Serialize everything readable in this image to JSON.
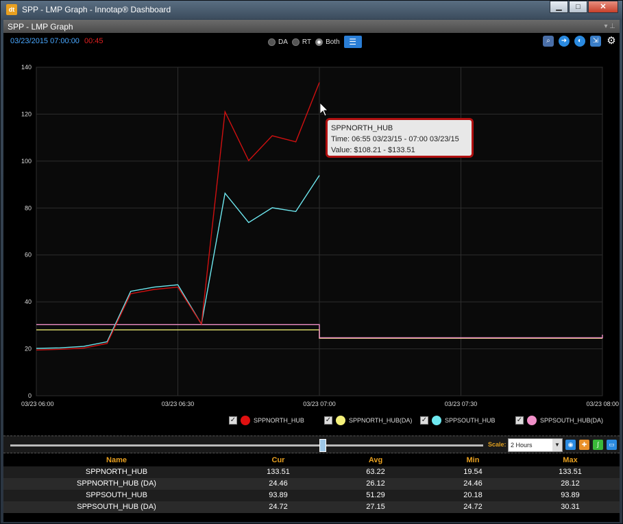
{
  "window": {
    "title": "SPP - LMP Graph - Innotap® Dashboard",
    "app_icon": "innotap-icon"
  },
  "panel": {
    "title": "SPP - LMP Graph"
  },
  "toolbar": {
    "timestamp": "03/23/2015 07:00:00",
    "countdown": "00:45",
    "radios": [
      {
        "label": "DA",
        "selected": false
      },
      {
        "label": "RT",
        "selected": false
      },
      {
        "label": "Both",
        "selected": true
      }
    ],
    "tools": [
      "zoom-icon",
      "arrow-right-icon",
      "info-icon",
      "export-icon",
      "settings-icon"
    ]
  },
  "tooltip": {
    "name": "SPPNORTH_HUB",
    "time": "Time: 06:55 03/23/15 - 07:00 03/23/15",
    "value": "Value: $108.21 - $133.51"
  },
  "chart_data": {
    "type": "line",
    "x_ticks": [
      "03/23 06:00",
      "03/23 06:30",
      "03/23 07:00",
      "03/23 07:30",
      "03/23 08:00"
    ],
    "ylim": [
      0,
      140
    ],
    "y_ticks": [
      "0",
      "20",
      "40",
      "60",
      "80",
      "100",
      "120",
      "140"
    ],
    "grid": true,
    "x_minutes_range": [
      0,
      120
    ],
    "series": [
      {
        "name": "SPPNORTH_HUB",
        "color": "#d01010",
        "points": [
          [
            0,
            19.5
          ],
          [
            5,
            19.8
          ],
          [
            10,
            20.3
          ],
          [
            15,
            22.3
          ],
          [
            20,
            43.5
          ],
          [
            25,
            45.3
          ],
          [
            30,
            46.3
          ],
          [
            35,
            30.5
          ],
          [
            40,
            121
          ],
          [
            45,
            100.2
          ],
          [
            50,
            110.8
          ],
          [
            55,
            108.2
          ],
          [
            60,
            133.5
          ]
        ]
      },
      {
        "name": "SPPNORTH_HUB(DA)",
        "color": "#e8e870",
        "points": [
          [
            0,
            28.1
          ],
          [
            60,
            28.1
          ],
          [
            60,
            24.5
          ],
          [
            120,
            24.5
          ]
        ]
      },
      {
        "name": "SPPSOUTH_HUB",
        "color": "#6ee8f0",
        "points": [
          [
            0,
            20.2
          ],
          [
            5,
            20.4
          ],
          [
            10,
            21
          ],
          [
            15,
            23
          ],
          [
            20,
            44.5
          ],
          [
            25,
            46.3
          ],
          [
            30,
            47.3
          ],
          [
            35,
            30.5
          ],
          [
            40,
            86.3
          ],
          [
            45,
            73.8
          ],
          [
            50,
            80.1
          ],
          [
            55,
            78.5
          ],
          [
            60,
            93.9
          ]
        ]
      },
      {
        "name": "SPPSOUTH_HUB(DA)",
        "color": "#f090c8",
        "points": [
          [
            0,
            30.3
          ],
          [
            60,
            30.3
          ],
          [
            60,
            24.7
          ],
          [
            120,
            24.7
          ],
          [
            120,
            26
          ]
        ]
      }
    ]
  },
  "legend": [
    {
      "label": "SPPNORTH_HUB",
      "color": "#e01010",
      "checked": true
    },
    {
      "label": "SPPNORTH_HUB(DA)",
      "color": "#f4f07a",
      "checked": true
    },
    {
      "label": "SPPSOUTH_HUB",
      "color": "#6ee8f0",
      "checked": true
    },
    {
      "label": "SPPSOUTH_HUB(DA)",
      "color": "#f090c8",
      "checked": true
    }
  ],
  "slider": {
    "scale_label": "Scale:",
    "scale_value": "2 Hours",
    "buttons": [
      "eye-icon",
      "plus-icon",
      "line-icon",
      "window-icon"
    ]
  },
  "table": {
    "headers": [
      "Name",
      "Cur",
      "Avg",
      "Min",
      "Max"
    ],
    "rows": [
      [
        "SPPNORTH_HUB",
        "133.51",
        "63.22",
        "19.54",
        "133.51"
      ],
      [
        "SPPNORTH_HUB (DA)",
        "24.46",
        "26.12",
        "24.46",
        "28.12"
      ],
      [
        "SPPSOUTH_HUB",
        "93.89",
        "51.29",
        "20.18",
        "93.89"
      ],
      [
        "SPPSOUTH_HUB (DA)",
        "24.72",
        "27.15",
        "24.72",
        "30.31"
      ]
    ]
  }
}
